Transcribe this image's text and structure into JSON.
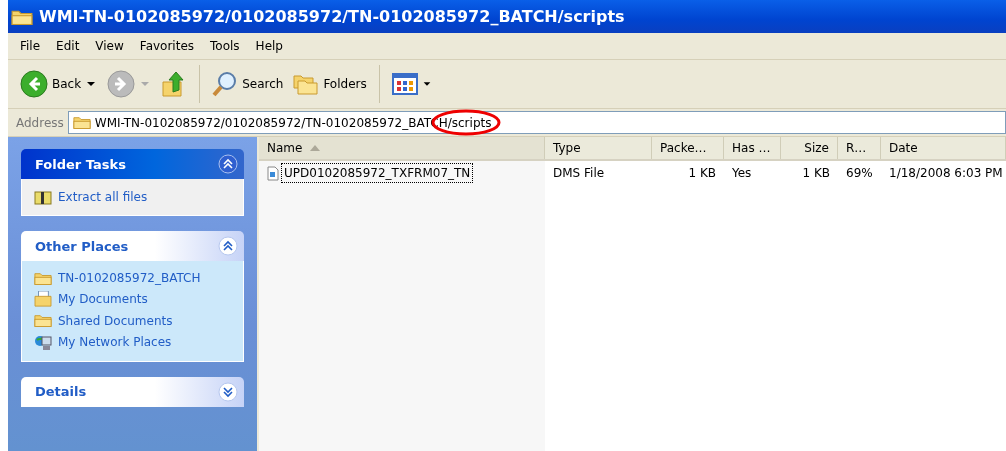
{
  "window": {
    "title": "WMI-TN-0102085972/0102085972/TN-0102085972_BATCH/scripts"
  },
  "menu": [
    "File",
    "Edit",
    "View",
    "Favorites",
    "Tools",
    "Help"
  ],
  "toolbar": [
    {
      "kind": "back",
      "label": "Back",
      "disabled": false
    },
    {
      "kind": "forward",
      "disabled": true
    },
    {
      "kind": "up"
    },
    {
      "kind": "search",
      "label": "Search"
    },
    {
      "kind": "folders",
      "label": "Folders"
    },
    {
      "kind": "views"
    }
  ],
  "address": {
    "label": "Address",
    "value": "WMI-TN-0102085972/0102085972/TN-0102085972_BATCH/scripts"
  },
  "panels": [
    {
      "kind": "primary",
      "title": "Folder Tasks",
      "expanded": true,
      "items": [
        {
          "kind": "zip",
          "label": "Extract all files"
        }
      ]
    },
    {
      "kind": "normal",
      "title": "Other Places",
      "expanded": true,
      "items": [
        {
          "kind": "folder",
          "label": "TN-0102085972_BATCH"
        },
        {
          "kind": "documents",
          "label": "My Documents"
        },
        {
          "kind": "folder",
          "label": "Shared Documents"
        },
        {
          "kind": "network",
          "label": "My Network Places"
        }
      ]
    },
    {
      "kind": "normal",
      "title": "Details",
      "expanded": false
    }
  ],
  "columns": [
    {
      "label": "Name",
      "sorted": true
    },
    {
      "label": "Type",
      "sorted": false
    },
    {
      "label": "Packe…",
      "sorted": false
    },
    {
      "label": "Has …",
      "sorted": false
    },
    {
      "label": "Size",
      "sorted": false
    },
    {
      "label": "R…",
      "sorted": false
    },
    {
      "label": "Date",
      "sorted": false
    }
  ],
  "rows": [
    {
      "focused": true,
      "cells": [
        "UPD0102085972_TXFRM07_TN",
        "DMS File",
        "1 KB",
        "Yes",
        "1 KB",
        "69%",
        "1/18/2008 6:03 PM"
      ]
    }
  ]
}
